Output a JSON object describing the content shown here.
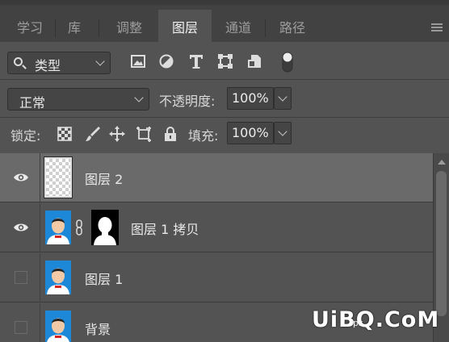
{
  "tabs": [
    {
      "label": "学习",
      "active": false
    },
    {
      "label": "库",
      "active": false
    },
    {
      "label": "调整",
      "active": false
    },
    {
      "label": "图层",
      "active": true
    },
    {
      "label": "通道",
      "active": false
    },
    {
      "label": "路径",
      "active": false
    }
  ],
  "filter": {
    "kind_label": "类型",
    "icons": [
      "image-filter-icon",
      "adjustment-filter-icon",
      "type-filter-icon",
      "shape-filter-icon",
      "smart-object-filter-icon",
      "filter-toggle-icon"
    ]
  },
  "blend": {
    "mode": "正常",
    "opacity_label": "不透明度:",
    "opacity_value": "100%"
  },
  "lock": {
    "label": "锁定:",
    "fill_label": "填充:",
    "fill_value": "100%",
    "icons": [
      "lock-transparent-pixels-icon",
      "lock-image-pixels-icon",
      "lock-position-icon",
      "prevent-auto-nesting-icon",
      "lock-all-icon"
    ]
  },
  "layers": [
    {
      "name": "图层 2",
      "visible": true,
      "selected": true,
      "thumb": "transparent",
      "mask": false
    },
    {
      "name": "图层 1 拷贝",
      "visible": true,
      "selected": false,
      "thumb": "photo",
      "mask": true
    },
    {
      "name": "图层 1",
      "visible": false,
      "selected": false,
      "thumb": "photo",
      "mask": false
    },
    {
      "name": "背景",
      "visible": false,
      "selected": false,
      "thumb": "photo",
      "mask": false
    }
  ],
  "watermark": {
    "text": "UiBQ.CoM",
    "sub": "ps"
  },
  "colors": {
    "panel": "#535353",
    "tabbar": "#424242",
    "selected_row": "#6a6a6a",
    "photo_bg": "#1e88d8"
  }
}
